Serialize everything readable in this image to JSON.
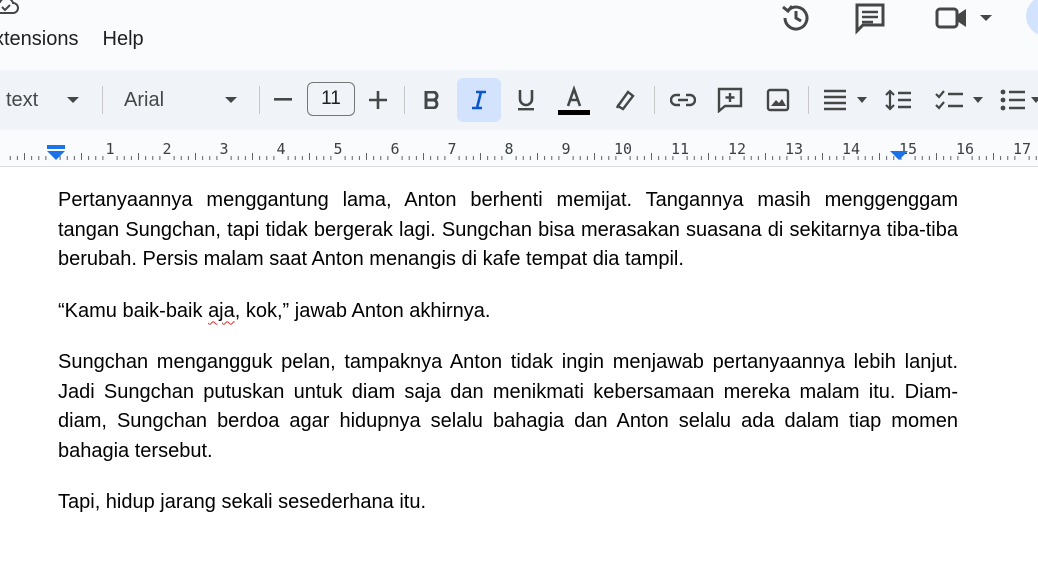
{
  "menu": {
    "items": [
      "xtensions",
      "Help"
    ]
  },
  "toolbar": {
    "style_label": "text",
    "font_label": "Arial",
    "font_size": "11",
    "text_color": "#000000",
    "active_tool": "italic"
  },
  "ruler": {
    "numbers": [
      "1",
      "2",
      "3",
      "4",
      "5",
      "6",
      "7",
      "8",
      "9",
      "10",
      "11",
      "12",
      "13",
      "14",
      "15",
      "16",
      "17"
    ]
  },
  "document": {
    "p1": "Pertanyaannya menggantung lama, Anton berhenti memijat. Tangannya masih menggenggam tangan Sungchan, tapi tidak bergerak lagi. Sungchan bisa merasakan suasana di sekitarnya tiba-tiba berubah. Persis malam saat Anton menangis di kafe tempat dia tampil.",
    "p2_before": "“Kamu baik-baik ",
    "p2_misspelled": "aja",
    "p2_after": ", kok,” jawab Anton akhirnya.",
    "p3": "Sungchan mengangguk pelan, tampaknya Anton tidak ingin menjawab pertanyaannya lebih lanjut. Jadi Sungchan putuskan untuk diam saja dan menikmati kebersamaan mereka malam itu. Diam-diam, Sungchan berdoa agar hidupnya selalu bahagia dan Anton selalu ada dalam tiap momen bahagia tersebut.",
    "p4": "Tapi, hidup jarang sekali sesederhana itu."
  },
  "colors": {
    "accent": "#1a73e8",
    "active_bg": "#d3e3fd",
    "toolbar_bg": "#f0f4f9"
  }
}
